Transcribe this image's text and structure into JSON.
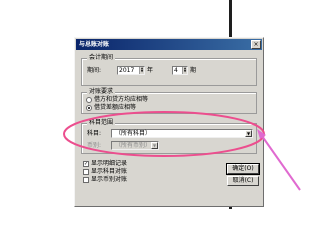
{
  "dialog": {
    "title": "与总账对账",
    "close_glyph": "×"
  },
  "period_group": {
    "label": "会计期间",
    "period_label": "期间:",
    "year_value": "2017",
    "year_unit": "年",
    "month_value": "4",
    "month_unit": "期"
  },
  "method_group": {
    "label": "对账要求",
    "options": [
      {
        "label": "借方和贷方均应相等",
        "selected": false
      },
      {
        "label": "借贷差额应相等",
        "selected": true
      }
    ]
  },
  "subject_group": {
    "label": "科目范围",
    "subject_label": "科目:",
    "subject_value": "（所有科目）",
    "currency_label": "币别:",
    "currency_value": "（所有币别）"
  },
  "options": {
    "show_detail": {
      "label": "显示明细记录",
      "checked": true
    },
    "show_subject": {
      "label": "显示科目对账",
      "checked": false
    },
    "show_currency": {
      "label": "显示币别对账",
      "checked": false
    }
  },
  "buttons": {
    "ok_label": "确定(O)",
    "cancel_label": "取消(C)"
  },
  "annotation": {
    "ellipse_color": "#ec4e8e",
    "arrow_color": "#e06ad0"
  }
}
